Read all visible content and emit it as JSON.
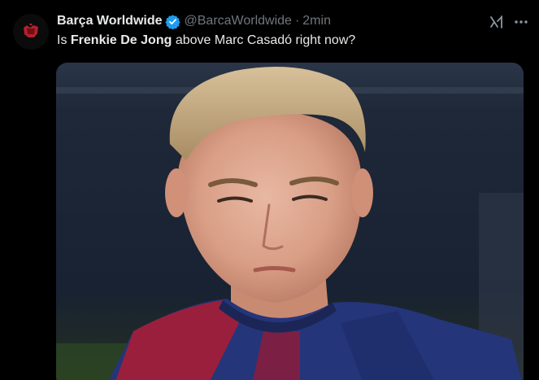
{
  "tweet": {
    "display_name": "Barça Worldwide",
    "handle": "@BarcaWorldwide",
    "separator": "·",
    "time": "2min",
    "text_prefix": "Is ",
    "text_bold": "Frenkie De Jong",
    "text_suffix": " above Marc Casadó right now?"
  },
  "icons": {
    "avatar": "barca-logo-icon",
    "verified": "verified-badge-icon",
    "grok": "grok-icon",
    "more": "more-dots-icon"
  },
  "colors": {
    "background": "#000000",
    "text_primary": "#e7e9ea",
    "text_secondary": "#71767b",
    "verified_blue": "#1d9bf0",
    "shirt_blue": "#24357a",
    "shirt_red": "#9a1f3c"
  }
}
